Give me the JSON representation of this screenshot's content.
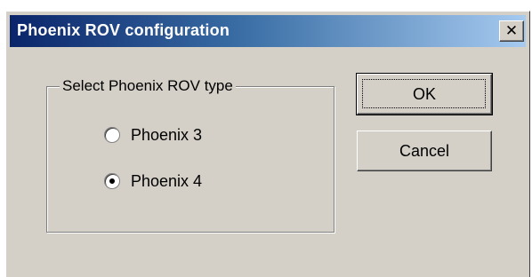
{
  "window": {
    "title": "Phoenix ROV configuration",
    "close_glyph": "✕",
    "close_icon": "close-icon"
  },
  "group": {
    "label": "Select Phoenix ROV type",
    "options": [
      {
        "label": "Phoenix 3",
        "selected": false
      },
      {
        "label": "Phoenix 4",
        "selected": true
      }
    ]
  },
  "buttons": {
    "ok_label": "OK",
    "cancel_label": "Cancel"
  },
  "colors": {
    "title_bar_start": "#0a246a",
    "title_bar_end": "#a6caf0",
    "dialog_face": "#d4d0c8"
  }
}
